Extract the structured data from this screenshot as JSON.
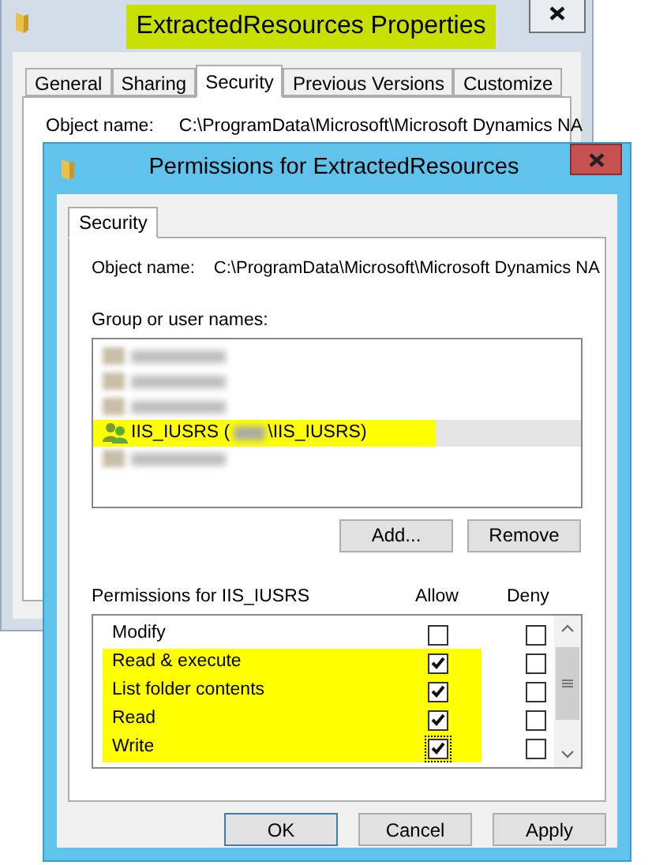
{
  "properties_window": {
    "title": "ExtractedResources Properties",
    "title_highlighted": true,
    "tabs": [
      {
        "label": "General",
        "selected": false
      },
      {
        "label": "Sharing",
        "selected": false
      },
      {
        "label": "Security",
        "selected": true
      },
      {
        "label": "Previous Versions",
        "selected": false
      },
      {
        "label": "Customize",
        "selected": false
      }
    ],
    "object_name_label": "Object name:",
    "object_name_value": "C:\\ProgramData\\Microsoft\\Microsoft Dynamics NA"
  },
  "permissions_dialog": {
    "title": "Permissions for ExtractedResources",
    "tabs": [
      {
        "label": "Security",
        "selected": true
      }
    ],
    "object_name_label": "Object name:",
    "object_name_value": "C:\\ProgramData\\Microsoft\\Microsoft Dynamics NA",
    "group_label": "Group or user names:",
    "users": [
      {
        "kind": "redacted",
        "selected": false,
        "highlighted": false
      },
      {
        "kind": "redacted",
        "selected": false,
        "highlighted": false
      },
      {
        "kind": "redacted",
        "selected": false,
        "highlighted": false
      },
      {
        "kind": "named",
        "name": "IIS_IUSRS (",
        "suffix": "\\IIS_IUSRS)",
        "selected": true,
        "highlighted": true
      },
      {
        "kind": "redacted",
        "selected": false,
        "highlighted": false
      }
    ],
    "list_buttons": [
      "Add...",
      "Remove"
    ],
    "permissions_label": "Permissions for IIS_IUSRS",
    "columns": [
      "Allow",
      "Deny"
    ],
    "permissions": [
      {
        "name": "Modify",
        "allow": false,
        "deny": false,
        "highlighted": false,
        "focused": false
      },
      {
        "name": "Read & execute",
        "allow": true,
        "deny": false,
        "highlighted": true,
        "focused": false
      },
      {
        "name": "List folder contents",
        "allow": true,
        "deny": false,
        "highlighted": true,
        "focused": false
      },
      {
        "name": "Read",
        "allow": true,
        "deny": false,
        "highlighted": true,
        "focused": false
      },
      {
        "name": "Write",
        "allow": true,
        "deny": false,
        "highlighted": true,
        "focused": true
      }
    ],
    "footer_buttons": [
      "OK",
      "Cancel",
      "Apply"
    ]
  }
}
